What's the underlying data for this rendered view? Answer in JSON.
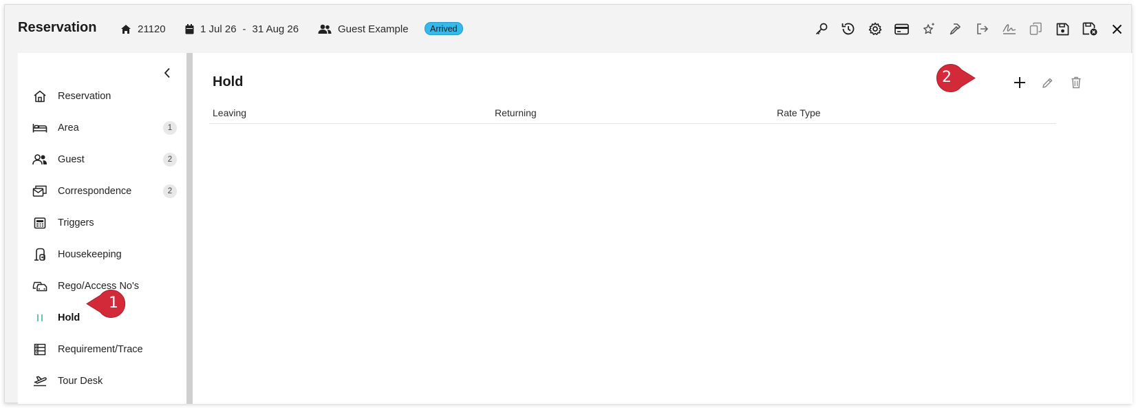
{
  "header": {
    "title": "Reservation",
    "reservation_number": "21120",
    "date_from": "1 Jul 26",
    "date_separator": "-",
    "date_to": "31 Aug 26",
    "guest_name": "Guest Example",
    "status": "Arrived",
    "status_color": "#35b8ea",
    "toolbar_icons": [
      "key-icon",
      "history-icon",
      "settings-icon",
      "card-icon",
      "sparkle-icon",
      "hammer-icon",
      "checkout-icon",
      "signature-icon",
      "copy-icon",
      "save-icon",
      "save-close-icon",
      "close-icon"
    ]
  },
  "sidebar": {
    "items": [
      {
        "label": "Reservation",
        "icon": "home-icon",
        "count": null
      },
      {
        "label": "Area",
        "icon": "bed-icon",
        "count": "1"
      },
      {
        "label": "Guest",
        "icon": "users-icon",
        "count": "2"
      },
      {
        "label": "Correspondence",
        "icon": "mail-icon",
        "count": "2"
      },
      {
        "label": "Triggers",
        "icon": "calendar-grid-icon",
        "count": null
      },
      {
        "label": "Housekeeping",
        "icon": "vacuum-icon",
        "count": null
      },
      {
        "label": "Rego/Access No's",
        "icon": "car-icon",
        "count": null
      },
      {
        "label": "Hold",
        "icon": "pause-icon",
        "count": null,
        "active": true
      },
      {
        "label": "Requirement/Trace",
        "icon": "list-icon",
        "count": null
      },
      {
        "label": "Tour Desk",
        "icon": "plane-icon",
        "count": null
      }
    ],
    "accent_color": "#3aa7a0"
  },
  "main": {
    "title": "Hold",
    "columns": [
      "Leaving",
      "Returning",
      "Rate Type"
    ],
    "rows": []
  },
  "callouts": [
    {
      "number": "1",
      "color": "#d32a3a"
    },
    {
      "number": "2",
      "color": "#d32a3a"
    }
  ]
}
